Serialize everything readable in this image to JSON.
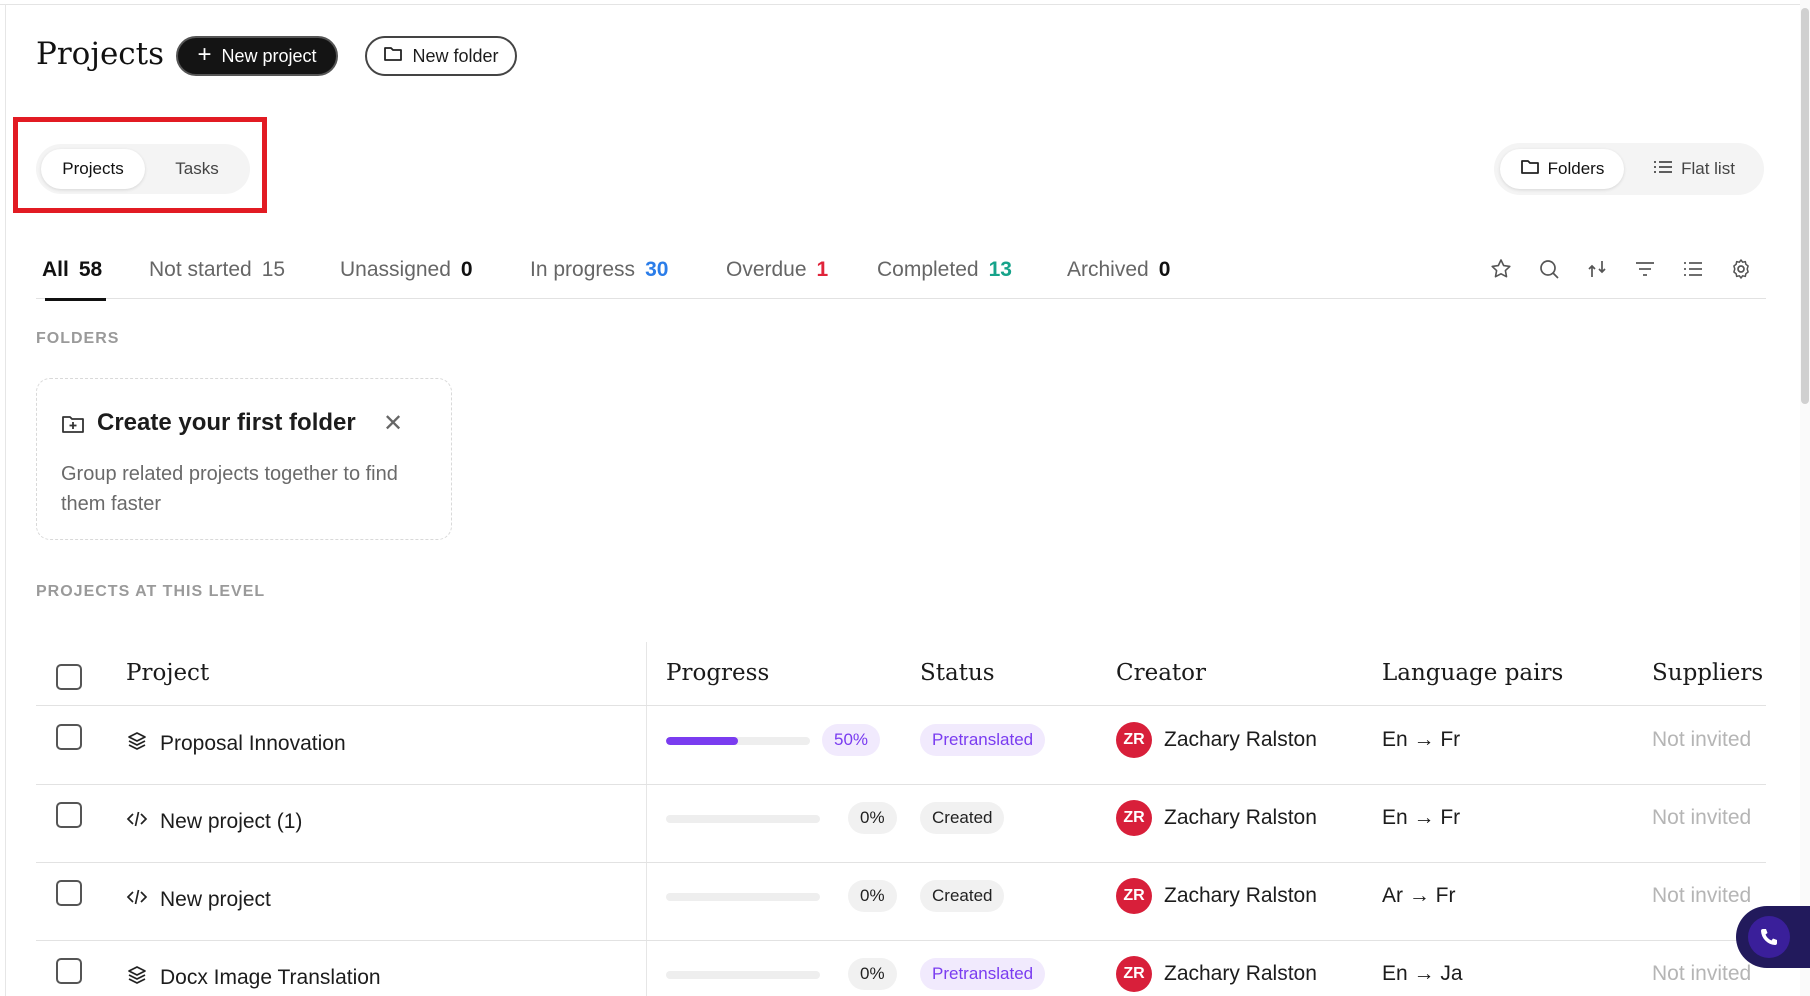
{
  "header": {
    "title": "Projects",
    "new_project_label": "New project",
    "new_folder_label": "New folder"
  },
  "view_toggle": {
    "projects": "Projects",
    "tasks": "Tasks",
    "active": "Projects"
  },
  "layout_toggle": {
    "folders": "Folders",
    "flat_list": "Flat list",
    "active": "Folders"
  },
  "filters": [
    {
      "label": "All",
      "count": "58",
      "color": "#111111",
      "active": true
    },
    {
      "label": "Not started",
      "count": "15",
      "color": "#666666",
      "active": false
    },
    {
      "label": "Unassigned",
      "count": "0",
      "color": "#111111",
      "active": false
    },
    {
      "label": "In progress",
      "count": "30",
      "color": "#2b7de9",
      "active": false
    },
    {
      "label": "Overdue",
      "count": "1",
      "color": "#e0243a",
      "active": false
    },
    {
      "label": "Completed",
      "count": "13",
      "color": "#16a38a",
      "active": false
    },
    {
      "label": "Archived",
      "count": "0",
      "color": "#111111",
      "active": false
    }
  ],
  "toolbar_icons": [
    "star-icon",
    "search-icon",
    "sort-icon",
    "filter-icon",
    "list-icon",
    "settings-icon"
  ],
  "folders_section": {
    "label": "FOLDERS",
    "card_title": "Create your first folder",
    "card_description": "Group related projects together to find them faster"
  },
  "projects_section": {
    "label": "PROJECTS AT THIS LEVEL"
  },
  "table": {
    "headers": {
      "project": "Project",
      "progress": "Progress",
      "status": "Status",
      "creator": "Creator",
      "language_pairs": "Language pairs",
      "suppliers": "Suppliers"
    },
    "rows": [
      {
        "name": "Proposal Innovation",
        "icon": "layers-icon",
        "progress": 0.5,
        "progress_label": "50%",
        "status": "Pretranslated",
        "creator_initials": "ZR",
        "creator": "Zachary Ralston",
        "language_pair": "En → Fr",
        "suppliers": "Not invited"
      },
      {
        "name": "New project (1)",
        "icon": "code-icon",
        "progress": 0,
        "progress_label": "0%",
        "status": "Created",
        "creator_initials": "ZR",
        "creator": "Zachary Ralston",
        "language_pair": "En → Fr",
        "suppliers": "Not invited"
      },
      {
        "name": "New project",
        "icon": "code-icon",
        "progress": 0,
        "progress_label": "0%",
        "status": "Created",
        "creator_initials": "ZR",
        "creator": "Zachary Ralston",
        "language_pair": "Ar → Fr",
        "suppliers": "Not invited"
      },
      {
        "name": "Docx Image Translation",
        "icon": "layers-icon",
        "progress": 0,
        "progress_label": "0%",
        "status": "Pretranslated",
        "creator_initials": "ZR",
        "creator": "Zachary Ralston",
        "language_pair": "En → Ja",
        "suppliers": "Not invited"
      }
    ]
  },
  "colors": {
    "accent": "#7a3cf0",
    "avatar": "#d81f3a",
    "highlight": "#e21b23"
  }
}
